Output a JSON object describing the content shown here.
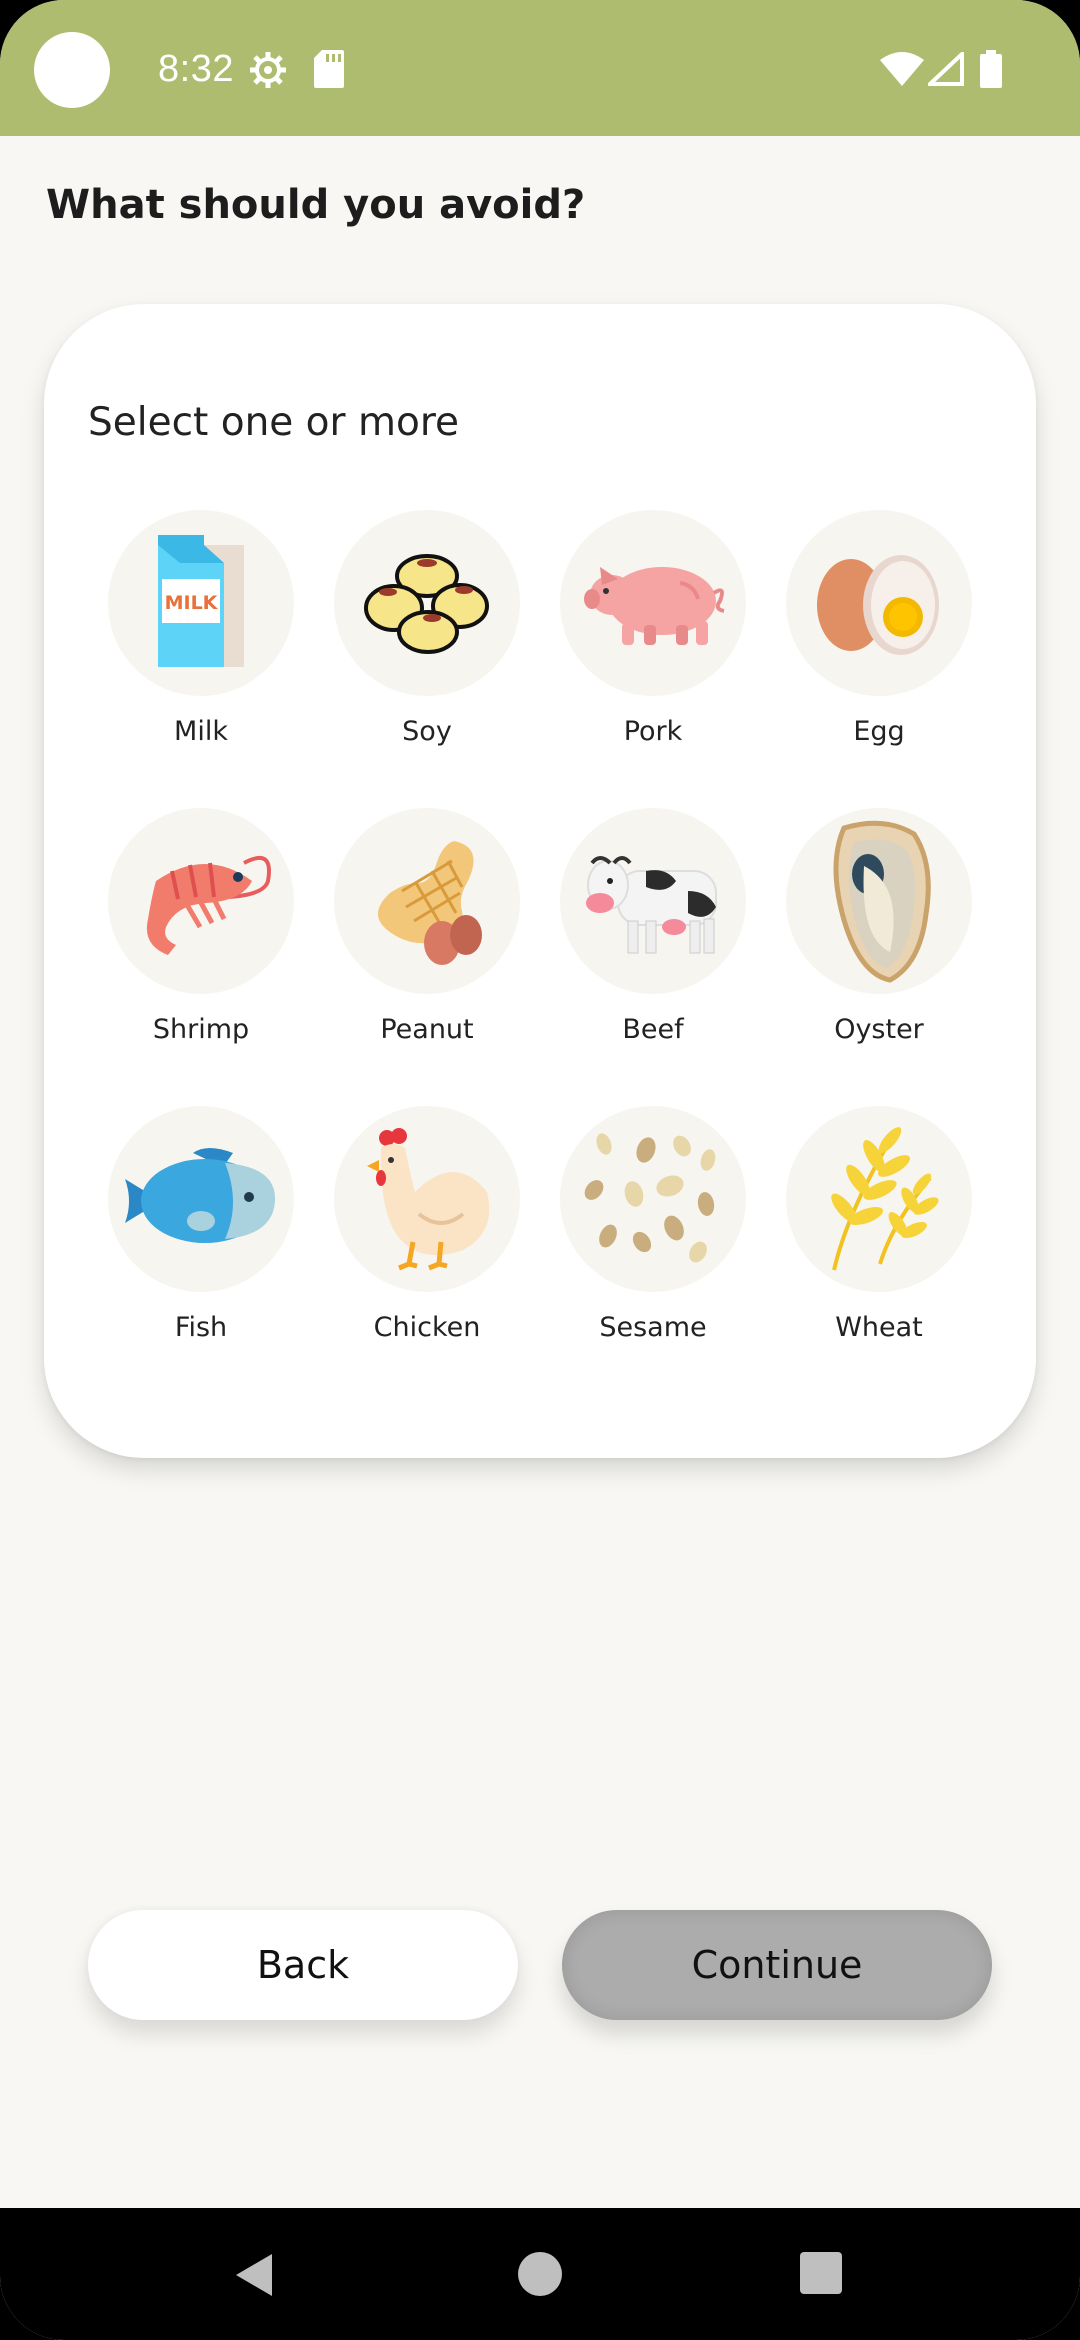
{
  "status_bar": {
    "time": "8:32",
    "icons": [
      "camera-cutout",
      "settings-gear-icon",
      "sd-card-icon",
      "wifi-icon",
      "cell-signal-icon",
      "battery-icon"
    ]
  },
  "page": {
    "title": "What should you avoid?"
  },
  "card": {
    "subtitle": "Select one or more",
    "allergens": [
      {
        "label": "Milk",
        "icon": "milk-carton-icon"
      },
      {
        "label": "Soy",
        "icon": "soybeans-icon"
      },
      {
        "label": "Pork",
        "icon": "pig-icon"
      },
      {
        "label": "Egg",
        "icon": "egg-icon"
      },
      {
        "label": "Shrimp",
        "icon": "shrimp-icon"
      },
      {
        "label": "Peanut",
        "icon": "peanut-icon"
      },
      {
        "label": "Beef",
        "icon": "cow-icon"
      },
      {
        "label": "Oyster",
        "icon": "oyster-icon"
      },
      {
        "label": "Fish",
        "icon": "fish-icon"
      },
      {
        "label": "Chicken",
        "icon": "chicken-icon"
      },
      {
        "label": "Sesame",
        "icon": "sesame-seeds-icon"
      },
      {
        "label": "Wheat",
        "icon": "wheat-icon"
      }
    ]
  },
  "buttons": {
    "back_label": "Back",
    "continue_label": "Continue"
  },
  "navigation": {
    "items": [
      "back-triangle-icon",
      "home-circle-icon",
      "recents-square-icon"
    ]
  },
  "colors": {
    "status_bar": "#aebc6f",
    "background": "#f8f7f3",
    "card": "#ffffff",
    "icon_circle": "#f7f5ef",
    "continue_disabled": "#acacac"
  }
}
